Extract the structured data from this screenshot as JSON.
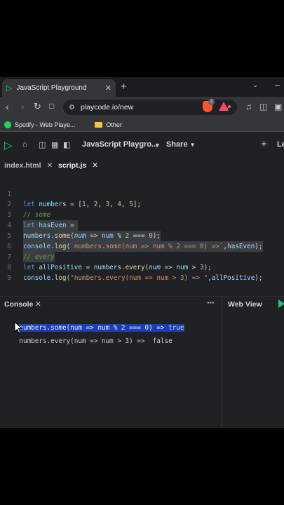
{
  "browser": {
    "tab_title": "JavaScript Playground",
    "url": "playcode.io/new",
    "bookmarks": [
      "Spotify - Web Playe...",
      "Other"
    ],
    "brave_badge": "2"
  },
  "app": {
    "project_name": "JavaScript Playgro...",
    "share_label": "Share",
    "cut_label": "Le"
  },
  "files": {
    "tabs": [
      "index.html",
      "script.js"
    ]
  },
  "editor": {
    "line_numbers": [
      "1",
      "2",
      "3",
      "4",
      "5",
      "6",
      "7",
      "8",
      "9"
    ]
  },
  "console": {
    "title": "Console",
    "webview_label": "Web View",
    "output": [
      {
        "text": "numbers.some(num => num % 2 === 0) =>",
        "value": "true"
      },
      {
        "text": "numbers.every(num => num > 3) =>",
        "value": "false"
      }
    ]
  }
}
